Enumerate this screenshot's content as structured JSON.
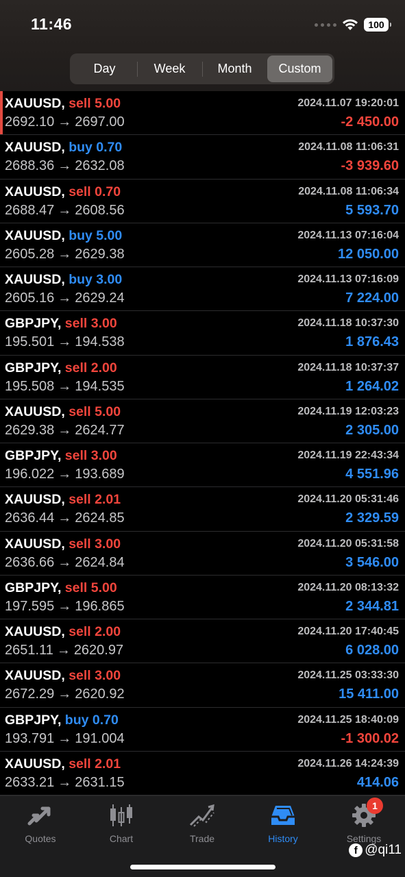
{
  "status": {
    "time": "11:46",
    "battery": "100",
    "icons": [
      "signal-icon",
      "wifi-icon",
      "battery-icon"
    ]
  },
  "segments": [
    {
      "label": "Day",
      "active": false
    },
    {
      "label": "Week",
      "active": false
    },
    {
      "label": "Month",
      "active": false
    },
    {
      "label": "Custom",
      "active": true
    }
  ],
  "colors": {
    "sell": "#f2453c",
    "buy": "#2f8cf5",
    "loss": "#f2453c",
    "profit": "#2f8cf5",
    "active_tab": "#2f8cf5"
  },
  "trades": [
    {
      "symbol": "XAUUSD,",
      "dir": "sell",
      "volume": "5.00",
      "open": "2692.10",
      "arrow": "→",
      "close": "2697.00",
      "time": "2024.11.07 19:20:01",
      "profit": "-2 450.00",
      "negative": true
    },
    {
      "symbol": "XAUUSD,",
      "dir": "buy",
      "volume": "0.70",
      "open": "2688.36",
      "arrow": "→",
      "close": "2632.08",
      "time": "2024.11.08 11:06:31",
      "profit": "-3 939.60",
      "negative": true
    },
    {
      "symbol": "XAUUSD,",
      "dir": "sell",
      "volume": "0.70",
      "open": "2688.47",
      "arrow": "→",
      "close": "2608.56",
      "time": "2024.11.08 11:06:34",
      "profit": "5 593.70",
      "negative": false
    },
    {
      "symbol": "XAUUSD,",
      "dir": "buy",
      "volume": "5.00",
      "open": "2605.28",
      "arrow": "→",
      "close": "2629.38",
      "time": "2024.11.13 07:16:04",
      "profit": "12 050.00",
      "negative": false
    },
    {
      "symbol": "XAUUSD,",
      "dir": "buy",
      "volume": "3.00",
      "open": "2605.16",
      "arrow": "→",
      "close": "2629.24",
      "time": "2024.11.13 07:16:09",
      "profit": "7 224.00",
      "negative": false
    },
    {
      "symbol": "GBPJPY,",
      "dir": "sell",
      "volume": "3.00",
      "open": "195.501",
      "arrow": "→",
      "close": "194.538",
      "time": "2024.11.18 10:37:30",
      "profit": "1 876.43",
      "negative": false
    },
    {
      "symbol": "GBPJPY,",
      "dir": "sell",
      "volume": "2.00",
      "open": "195.508",
      "arrow": "→",
      "close": "194.535",
      "time": "2024.11.18 10:37:37",
      "profit": "1 264.02",
      "negative": false
    },
    {
      "symbol": "XAUUSD,",
      "dir": "sell",
      "volume": "5.00",
      "open": "2629.38",
      "arrow": "→",
      "close": "2624.77",
      "time": "2024.11.19 12:03:23",
      "profit": "2 305.00",
      "negative": false
    },
    {
      "symbol": "GBPJPY,",
      "dir": "sell",
      "volume": "3.00",
      "open": "196.022",
      "arrow": "→",
      "close": "193.689",
      "time": "2024.11.19 22:43:34",
      "profit": "4 551.96",
      "negative": false
    },
    {
      "symbol": "XAUUSD,",
      "dir": "sell",
      "volume": "2.01",
      "open": "2636.44",
      "arrow": "→",
      "close": "2624.85",
      "time": "2024.11.20 05:31:46",
      "profit": "2 329.59",
      "negative": false
    },
    {
      "symbol": "XAUUSD,",
      "dir": "sell",
      "volume": "3.00",
      "open": "2636.66",
      "arrow": "→",
      "close": "2624.84",
      "time": "2024.11.20 05:31:58",
      "profit": "3 546.00",
      "negative": false
    },
    {
      "symbol": "GBPJPY,",
      "dir": "sell",
      "volume": "5.00",
      "open": "197.595",
      "arrow": "→",
      "close": "196.865",
      "time": "2024.11.20 08:13:32",
      "profit": "2 344.81",
      "negative": false
    },
    {
      "symbol": "XAUUSD,",
      "dir": "sell",
      "volume": "2.00",
      "open": "2651.11",
      "arrow": "→",
      "close": "2620.97",
      "time": "2024.11.20 17:40:45",
      "profit": "6 028.00",
      "negative": false
    },
    {
      "symbol": "XAUUSD,",
      "dir": "sell",
      "volume": "3.00",
      "open": "2672.29",
      "arrow": "→",
      "close": "2620.92",
      "time": "2024.11.25 03:33:30",
      "profit": "15 411.00",
      "negative": false
    },
    {
      "symbol": "GBPJPY,",
      "dir": "buy",
      "volume": "0.70",
      "open": "193.791",
      "arrow": "→",
      "close": "191.004",
      "time": "2024.11.25 18:40:09",
      "profit": "-1 300.02",
      "negative": true
    },
    {
      "symbol": "XAUUSD,",
      "dir": "sell",
      "volume": "2.01",
      "open": "2633.21",
      "arrow": "→",
      "close": "2631.15",
      "time": "2024.11.26 14:24:39",
      "profit": "414.06",
      "negative": false
    }
  ],
  "tabs": [
    {
      "label": "Quotes",
      "icon": "quotes-arrows-icon",
      "active": false
    },
    {
      "label": "Chart",
      "icon": "candlestick-icon",
      "active": false
    },
    {
      "label": "Trade",
      "icon": "trend-icon",
      "active": false
    },
    {
      "label": "History",
      "icon": "inbox-tray-icon",
      "active": true
    },
    {
      "label": "Settings",
      "icon": "gear-icon",
      "active": false,
      "badge": "1"
    }
  ],
  "watermark": {
    "icon": "facebook-icon",
    "text": "@qi11"
  }
}
